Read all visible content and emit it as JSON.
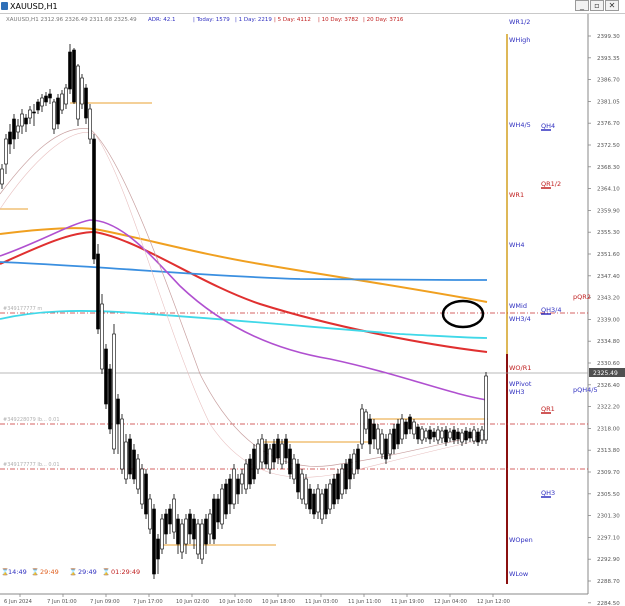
{
  "window": {
    "title": "XAUUSD,H1",
    "buttons": {
      "minimize": "_",
      "restore": "▫",
      "close": "✕"
    },
    "fix_button": "▾"
  },
  "header": {
    "symbol_line": "XAUUSD,H1  2312.96 2326.49 2311.68 2325.49",
    "adr": "ADR: 42.1",
    "today": "| Today: 1579",
    "day1": "| 1 Day: 2219",
    "day5": "| 5 Day: 4112",
    "day10": "| 10 Day: 3782",
    "day20": "| 20 Day: 3716"
  },
  "price_axis": {
    "ticks": [
      "2399.30",
      "2393.35",
      "2386.70",
      "2381.05",
      "2376.70",
      "2372.50",
      "2368.30",
      "2364.10",
      "2359.90",
      "2355.30",
      "2351.60",
      "2347.40",
      "2343.20",
      "2339.00",
      "2334.80",
      "2330.60",
      "2326.40",
      "2322.20",
      "2318.00",
      "2313.80",
      "2309.70",
      "2305.50",
      "2301.30",
      "2297.10",
      "2292.90",
      "2288.70",
      "2284.50"
    ],
    "current_price": "2325.49",
    "current_price_color": "#505050"
  },
  "time_axis": {
    "labels": [
      "6 Jun 2024",
      "7 Jun 01:00",
      "7 Jun 09:00",
      "7 Jun 17:00",
      "10 Jun 02:00",
      "10 Jun 10:00",
      "10 Jun 18:00",
      "11 Jun 03:00",
      "11 Jun 11:00",
      "11 Jun 19:00",
      "12 Jun 04:00",
      "12 Jun 12:00"
    ]
  },
  "pivot_labels": {
    "weekly": [
      "WR1/2",
      "WHigh",
      "WH4/5",
      "WR1",
      "WH4",
      "WMid",
      "WH3/4",
      "WO/R1",
      "WPivot",
      "WH3",
      "WOpen",
      "WLow"
    ],
    "quarter": [
      "QH4",
      "QR1/2",
      "QH3/4",
      "QR1",
      "QH3"
    ],
    "prior": [
      "pQR2",
      "pQH4/5"
    ]
  },
  "line_tags": {
    "upper_level": "#349177777 m",
    "mid_level": "#349228079 Ib... 0.01",
    "low_level": "#349177777 Ib... 0.01"
  },
  "timers": {
    "t1": "14:49",
    "t2": "29:49",
    "t3": "29:49",
    "t4": "01:29:49"
  },
  "colors": {
    "bull_candle": "#ffffff",
    "bear_candle": "#000000",
    "ma_orange": "#f0a020",
    "ma_red": "#e03030",
    "ma_blue": "#3a8fe0",
    "ma_cyan": "#40d8e8",
    "ma_purple": "#b050d0",
    "level_red": "#c83030",
    "pivot_text_blue": "#3030c0"
  },
  "annotation": {
    "shape": "ellipse",
    "color": "#000000"
  }
}
